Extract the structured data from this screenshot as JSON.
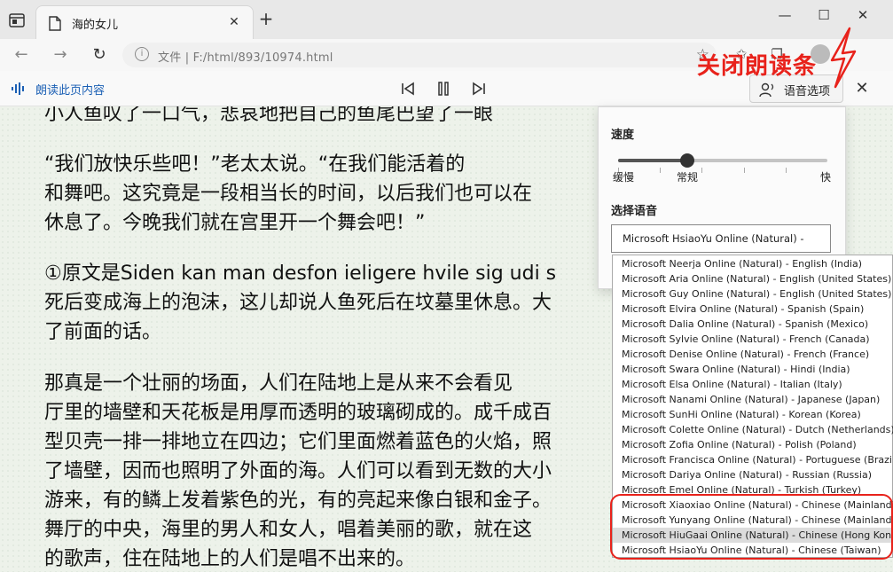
{
  "tab": {
    "title": "海的女儿"
  },
  "address": {
    "prefix": "文件",
    "url": "F:/html/893/10974.html"
  },
  "readbar": {
    "label": "朗读此页内容",
    "voice_options": "语音选项"
  },
  "annotation": "关闭朗读条",
  "content": {
    "paragraphs": [
      "    小人鱼叹了一口气，悲哀地把自己的鱼尾巴望了一眼",
      "    “我们放快乐些吧！”老太太说。“在我们能活着的",
      "和舞吧。这究竟是一段相当长的时间，以后我们也可以在",
      "休息了。今晚我们就在宫里开一个舞会吧！”",
      "①原文是Siden kan man desfon ieligere hvile sig udi s",
      "死后变成海上的泡沫，这儿却说人鱼死后在坟墓里休息。大",
      "了前面的话。",
      "    那真是一个壮丽的场面，人们在陆地上是从来不会看见",
      "厅里的墙壁和天花板是用厚而透明的玻璃砌成的。成千成百",
      "型贝壳一排一排地立在四边；它们里面燃着蓝色的火焰，照",
      "了墙壁，因而也照明了外面的海。人们可以看到无数的大小",
      "游来，有的鳞上发着紫色的光，有的亮起来像白银和金子。",
      "舞厅的中央，海里的男人和女人，唱着美丽的歌，就在这",
      "的歌声，住在陆地上的人们是唱不出来的。"
    ]
  },
  "panel": {
    "speed_heading": "速度",
    "speed_slow": "缓慢",
    "speed_normal": "常规",
    "speed_fast": "快",
    "speed_value": 0.33,
    "voice_heading": "选择语音",
    "selected_voice": "Microsoft HsiaoYu Online (Natural) - "
  },
  "voices": [
    "Microsoft Neerja Online (Natural) - English (India)",
    "Microsoft Aria Online (Natural) - English (United States)",
    "Microsoft Guy Online (Natural) - English (United States)",
    "Microsoft Elvira Online (Natural) - Spanish (Spain)",
    "Microsoft Dalia Online (Natural) - Spanish (Mexico)",
    "Microsoft Sylvie Online (Natural) - French (Canada)",
    "Microsoft Denise Online (Natural) - French (France)",
    "Microsoft Swara Online (Natural) - Hindi (India)",
    "Microsoft Elsa Online (Natural) - Italian (Italy)",
    "Microsoft Nanami Online (Natural) - Japanese (Japan)",
    "Microsoft SunHi Online (Natural) - Korean (Korea)",
    "Microsoft Colette Online (Natural) - Dutch (Netherlands)",
    "Microsoft Zofia Online (Natural) - Polish (Poland)",
    "Microsoft Francisca Online (Natural) - Portuguese (Brazil)",
    "Microsoft Dariya Online (Natural) - Russian (Russia)",
    "Microsoft Emel Online (Natural) - Turkish (Turkey)",
    "Microsoft Xiaoxiao Online (Natural) - Chinese (Mainland)",
    "Microsoft Yunyang Online (Natural) - Chinese (Mainland)",
    "Microsoft HiuGaai Online (Natural) - Chinese (Hong Kong)",
    "Microsoft HsiaoYu Online (Natural) - Chinese (Taiwan)"
  ],
  "selected_voice_index": 18,
  "colors": {
    "accent": "#1a5fb4",
    "annotation": "#e8221b"
  }
}
